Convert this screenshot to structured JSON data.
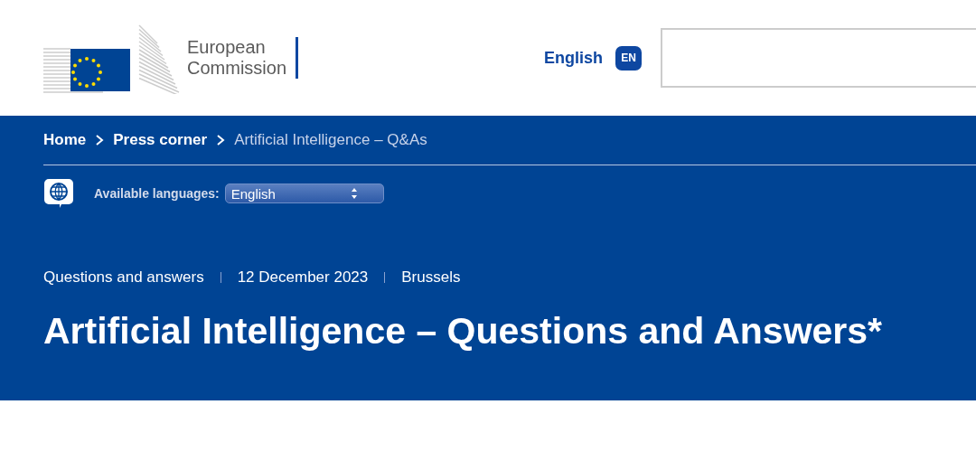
{
  "header": {
    "logo_text": [
      "European",
      "Commission"
    ],
    "language": {
      "label": "English",
      "code": "EN"
    }
  },
  "breadcrumb": [
    {
      "label": "Home",
      "kind": "link"
    },
    {
      "label": "Press corner",
      "kind": "link"
    },
    {
      "label": "Artificial Intelligence – Q&As",
      "kind": "current"
    }
  ],
  "languages": {
    "label": "Available languages:",
    "value": "English"
  },
  "meta": [
    "Questions and answers",
    "12 December 2023",
    "Brussels"
  ],
  "title": "Artificial Intelligence – Questions and Answers*"
}
